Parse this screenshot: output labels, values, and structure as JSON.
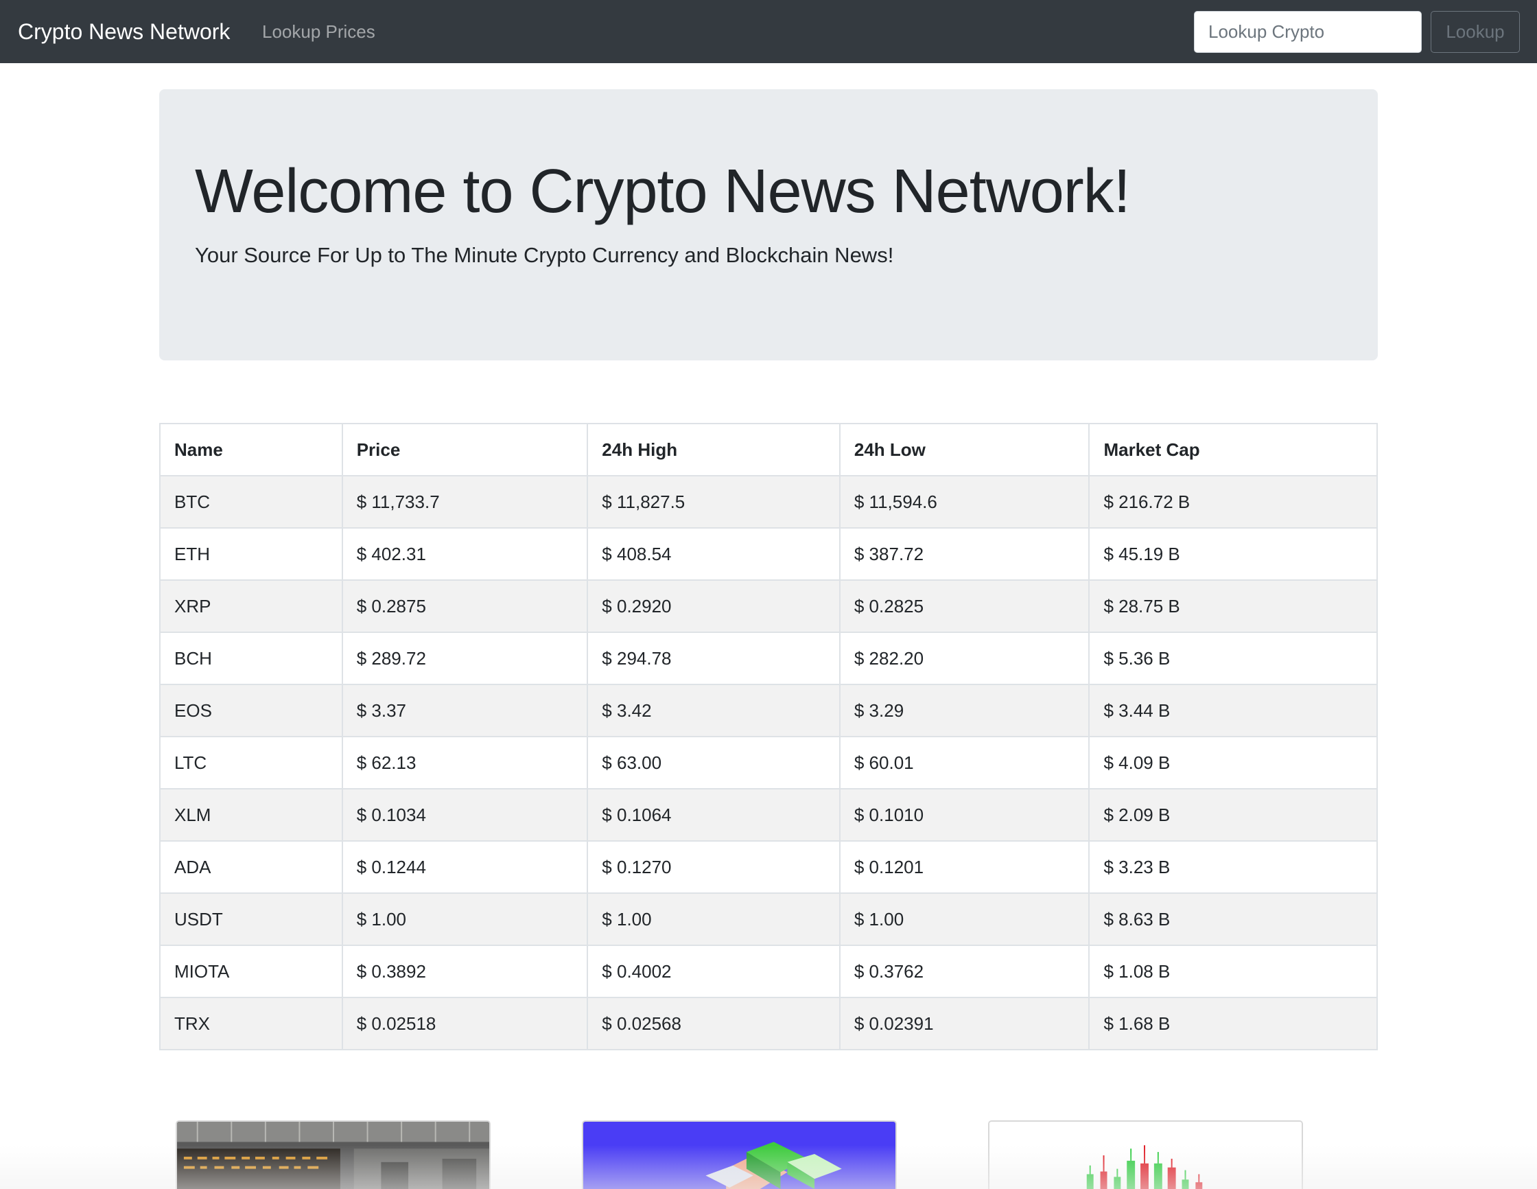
{
  "navbar": {
    "brand": "Crypto News Network",
    "link_lookup_prices": "Lookup Prices",
    "search_placeholder": "Lookup Crypto",
    "search_button": "Lookup",
    "background_color": "#343a40"
  },
  "jumbotron": {
    "title": "Welcome to Crypto News Network!",
    "lead": "Your Source For Up to The Minute Crypto Currency and Blockchain News!",
    "background_color": "#e9ecef"
  },
  "table": {
    "headers": [
      "Name",
      "Price",
      "24h High",
      "24h Low",
      "Market Cap"
    ],
    "rows": [
      [
        "BTC",
        "$ 11,733.7",
        "$ 11,827.5",
        "$ 11,594.6",
        "$ 216.72 B"
      ],
      [
        "ETH",
        "$ 402.31",
        "$ 408.54",
        "$ 387.72",
        "$ 45.19 B"
      ],
      [
        "XRP",
        "$ 0.2875",
        "$ 0.2920",
        "$ 0.2825",
        "$ 28.75 B"
      ],
      [
        "BCH",
        "$ 289.72",
        "$ 294.78",
        "$ 282.20",
        "$ 5.36 B"
      ],
      [
        "EOS",
        "$ 3.37",
        "$ 3.42",
        "$ 3.29",
        "$ 3.44 B"
      ],
      [
        "LTC",
        "$ 62.13",
        "$ 63.00",
        "$ 60.01",
        "$ 4.09 B"
      ],
      [
        "XLM",
        "$ 0.1034",
        "$ 0.1064",
        "$ 0.1010",
        "$ 2.09 B"
      ],
      [
        "ADA",
        "$ 0.1244",
        "$ 0.1270",
        "$ 0.1201",
        "$ 3.23 B"
      ],
      [
        "USDT",
        "$ 1.00",
        "$ 1.00",
        "$ 1.00",
        "$ 8.63 B"
      ],
      [
        "MIOTA",
        "$ 0.3892",
        "$ 0.4002",
        "$ 0.3762",
        "$ 1.08 B"
      ],
      [
        "TRX",
        "$ 0.02518",
        "$ 0.02568",
        "$ 0.02391",
        "$ 1.68 B"
      ]
    ]
  },
  "news_cards": [
    {
      "image": "trading-floor-photo"
    },
    {
      "image": "isometric-blockchain-illustration",
      "accent": "#4a3df5"
    },
    {
      "image": "candlestick-chart-graphic",
      "up_color": "#2ecc40",
      "down_color": "#e01b24"
    }
  ]
}
